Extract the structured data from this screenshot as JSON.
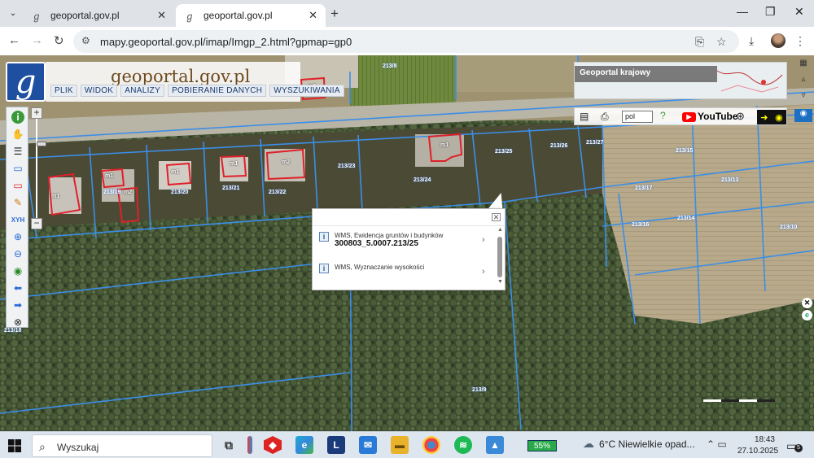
{
  "browser": {
    "tabs": [
      {
        "title": "geoportal.gov.pl",
        "active": false
      },
      {
        "title": "geoportal.gov.pl",
        "active": true
      }
    ],
    "url": "mapy.geoportal.gov.pl/imap/Imgp_2.html?gpmap=gp0"
  },
  "geoportal": {
    "brand_title": "geoportal.gov.pl",
    "menu": [
      "PLIK",
      "WIDOK",
      "ANALIZY",
      "POBIERANIE DANYCH",
      "WYSZUKIWANIA"
    ],
    "overview_label": "Geoportal krajowy",
    "language": "pol",
    "youtube_label": "YouTube"
  },
  "map": {
    "parcel_labels": [
      "213/23",
      "213/22",
      "213/19",
      "213/21",
      "213/20",
      "213/18",
      "213/24",
      "213/25",
      "213/26",
      "213/27",
      "213/17",
      "213/16",
      "213/15",
      "213/14",
      "213/13",
      "213/10",
      "213/9",
      "213/8"
    ],
    "building_labels": [
      "m2",
      "m1",
      "m1",
      "m2",
      "m1",
      "m1",
      "m2",
      "m1"
    ]
  },
  "popup": {
    "items": [
      {
        "layer": "WMS, Ewidencja gruntów i budynków",
        "value": "300803_5.0007.213/25"
      },
      {
        "layer": "WMS, Wyznaczanie wysokości",
        "value": ""
      }
    ]
  },
  "taskbar": {
    "search_placeholder": "Wyszukaj",
    "battery": "55%",
    "weather": "6°C  Niewielkie opad...",
    "time": "18:43",
    "date": "27.10.2025",
    "notifications": "5"
  }
}
